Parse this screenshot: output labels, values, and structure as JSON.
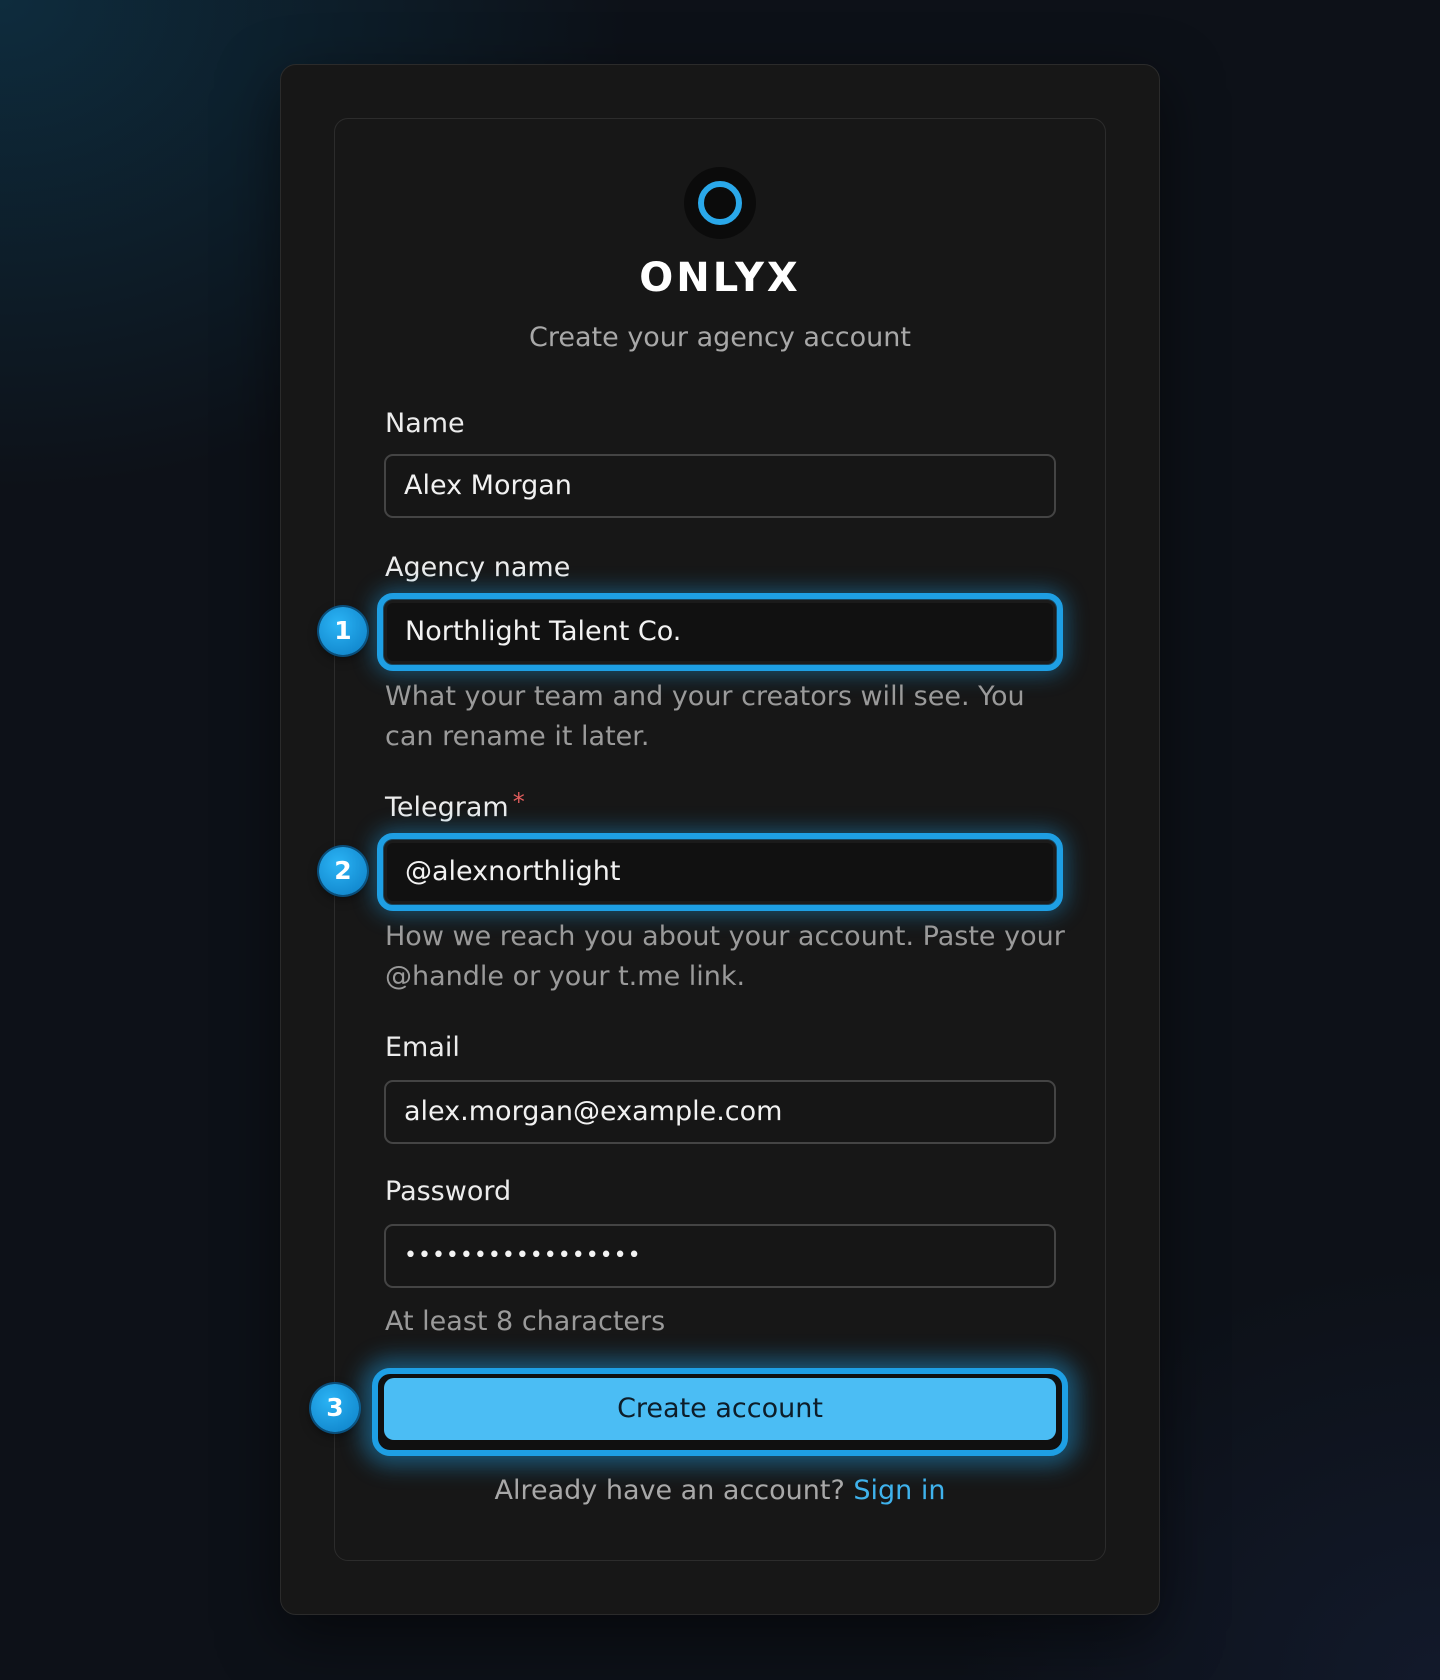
{
  "brand": {
    "name": "ONLYX",
    "subtitle": "Create your agency account"
  },
  "form": {
    "name": {
      "label": "Name",
      "value": "Alex Morgan"
    },
    "agency": {
      "label": "Agency name",
      "value": "Northlight Talent Co.",
      "hint": "What your team and your creators will see. You can rename it later."
    },
    "telegram": {
      "label": "Telegram",
      "required_mark": "*",
      "value": "@alexnorthlight",
      "hint": "How we reach you about your account. Paste your @handle or your t.me link."
    },
    "email": {
      "label": "Email",
      "value": "alex.morgan@example.com"
    },
    "password": {
      "label": "Password",
      "value": "•••••••••••••••••",
      "hint": "At least 8 characters"
    },
    "submit_label": "Create account"
  },
  "footer": {
    "prompt": "Already have an account?",
    "link": "Sign in"
  },
  "annotations": [
    "1",
    "2",
    "3"
  ],
  "colors": {
    "accent": "#1e9fe4",
    "button": "#4bbdf4",
    "card": "#171717",
    "required": "#e25d5d"
  }
}
